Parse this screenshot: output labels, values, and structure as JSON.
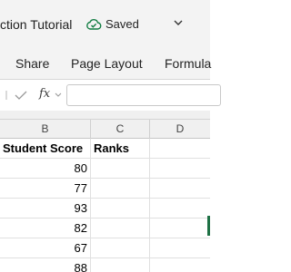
{
  "titlebar": {
    "doc_title": "ction Tutorial",
    "saved_label": "Saved"
  },
  "ribbon": {
    "tabs": [
      "Share",
      "Page Layout",
      "Formula"
    ]
  },
  "formula_bar": {
    "fx_label": "fx",
    "value": ""
  },
  "grid": {
    "columns": [
      "B",
      "C",
      "D"
    ],
    "header_row": [
      "Student Score",
      "Ranks",
      ""
    ],
    "scores": [
      "80",
      "77",
      "93",
      "82",
      "67",
      "88"
    ]
  },
  "colors": {
    "accent_green": "#1e7145",
    "saved_icon": "#107c41"
  }
}
